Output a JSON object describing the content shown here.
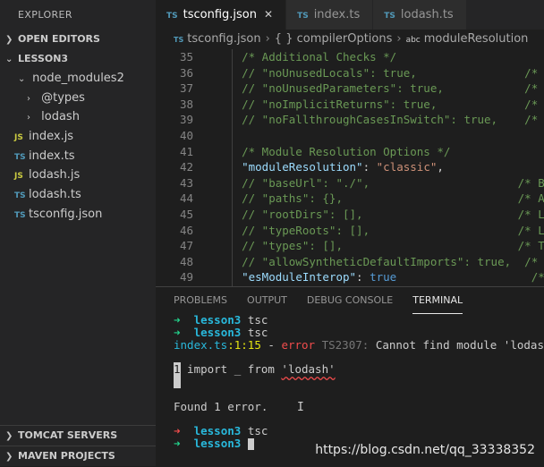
{
  "sidebar": {
    "title": "EXPLORER",
    "open_editors": "OPEN EDITORS",
    "project": "LESSON3",
    "items": [
      {
        "label": "node_modules2",
        "icon": "chevron-down-icon"
      },
      {
        "label": "@types",
        "icon": "chevron-right-icon"
      },
      {
        "label": "lodash",
        "icon": "chevron-right-icon"
      },
      {
        "label": "index.js",
        "badge": "JS"
      },
      {
        "label": "index.ts",
        "badge": "TS"
      },
      {
        "label": "lodash.js",
        "badge": "JS"
      },
      {
        "label": "lodash.ts",
        "badge": "TS"
      },
      {
        "label": "tsconfig.json",
        "badge": "TS"
      }
    ],
    "tomcat": "TOMCAT SERVERS",
    "maven": "MAVEN PROJECTS"
  },
  "tabs": [
    {
      "label": "tsconfig.json",
      "badge": "TS",
      "close": "✕"
    },
    {
      "label": "index.ts",
      "badge": "TS"
    },
    {
      "label": "lodash.ts",
      "badge": "TS"
    }
  ],
  "breadcrumb": {
    "file": "tsconfig.json",
    "badge": "TS",
    "sep": "›",
    "obj": "{ }",
    "section": "compilerOptions",
    "abc": "abc",
    "prop": "moduleResolution"
  },
  "code_lines": [
    {
      "n": "35",
      "t": "    /* Additional Checks */",
      "k": "com"
    },
    {
      "n": "36",
      "t": "    // \"noUnusedLocals\": true,                /* R",
      "k": "com"
    },
    {
      "n": "37",
      "t": "    // \"noUnusedParameters\": true,            /* R",
      "k": "com"
    },
    {
      "n": "38",
      "t": "    // \"noImplicitReturns\": true,             /* R",
      "k": "com"
    },
    {
      "n": "39",
      "t": "    // \"noFallthroughCasesInSwitch\": true,    /* R",
      "k": "com"
    },
    {
      "n": "40",
      "t": "",
      "k": "com"
    },
    {
      "n": "41",
      "t": "    /* Module Resolution Options */",
      "k": "com"
    },
    {
      "n": "42",
      "pre": "    ",
      "key": "\"moduleResolution\"",
      "mid": ": ",
      "val": "\"classic\"",
      "post": ",",
      "cm": "                  /* S",
      "k": "kv-str"
    },
    {
      "n": "43",
      "t": "    // \"baseUrl\": \"./\",                      /* B",
      "k": "com"
    },
    {
      "n": "44",
      "t": "    // \"paths\": {},                          /* A",
      "k": "com"
    },
    {
      "n": "45",
      "t": "    // \"rootDirs\": [],                       /* L",
      "k": "com"
    },
    {
      "n": "46",
      "t": "    // \"typeRoots\": [],                      /* L",
      "k": "com"
    },
    {
      "n": "47",
      "t": "    // \"types\": [],                          /* T",
      "k": "com"
    },
    {
      "n": "48",
      "t": "    // \"allowSyntheticDefaultImports\": true,  /* A",
      "k": "com"
    },
    {
      "n": "49",
      "pre": "    ",
      "key": "\"esModuleInterop\"",
      "mid": ": ",
      "val": "true",
      "post": "",
      "cm": "                    /* E",
      "k": "kv-kw"
    }
  ],
  "panel": {
    "tabs": [
      "PROBLEMS",
      "OUTPUT",
      "DEBUG CONSOLE",
      "TERMINAL"
    ],
    "active": 3
  },
  "terminal": {
    "arrow": "➜",
    "cwd": "lesson3",
    "cmd": "tsc",
    "err_file": "index.ts",
    "err_pos": ":1:15",
    "err_dash": " - ",
    "err_word": "error",
    "err_code": " TS2307:",
    "err_msg": " Cannot find module 'lodash'.",
    "src_num": "1",
    "src_pre": " import _ from ",
    "src_mod": "'lodash'",
    "found": "Found 1 error."
  },
  "ibeam": "I",
  "watermark": "https://blog.csdn.net/qq_33338352"
}
